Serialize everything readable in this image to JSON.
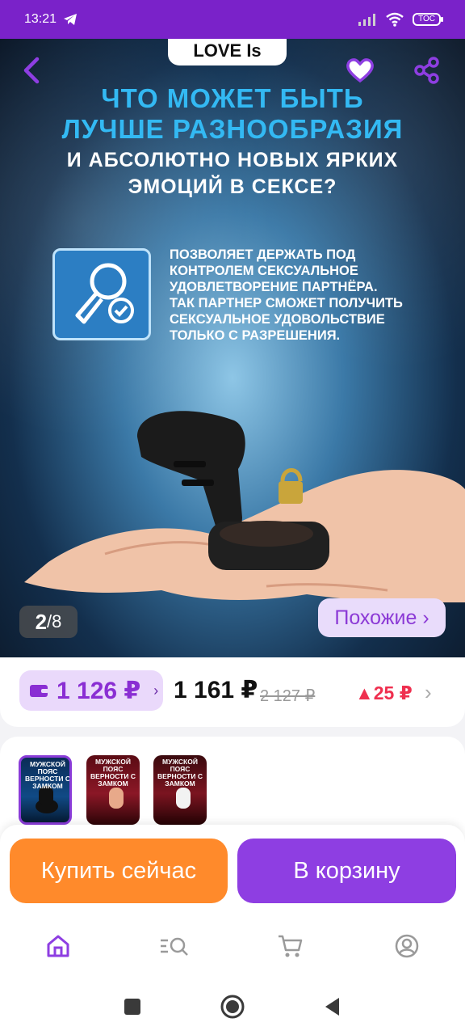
{
  "status_bar": {
    "time": "13:21",
    "battery_label": "TOC"
  },
  "hero": {
    "brand": "LOVE Is",
    "headline_line1": "ЧТО МОЖЕТ БЫТЬ",
    "headline_line2": "ЛУЧШЕ РАЗНООБРАЗИЯ",
    "subheadline_line1": "И АБСОЛЮТНО НОВЫХ ЯРКИХ",
    "subheadline_line2": "ЭМОЦИЙ В СЕКСЕ?",
    "feature_line1": "ПОЗВОЛЯЕТ ДЕРЖАТЬ ПОД",
    "feature_line2": "КОНТРОЛЕМ СЕКСУАЛЬНОЕ",
    "feature_line3": "УДОВЛЕТВОРЕНИЕ ПАРТНЁРА.",
    "feature_line4": "ТАК ПАРТНЕР СМОЖЕТ ПОЛУЧИТЬ",
    "feature_line5": "СЕКСУАЛЬНОЕ УДОВОЛЬСТВИЕ",
    "feature_line6": "ТОЛЬКО С РАЗРЕШЕНИЯ.",
    "page_current": "2",
    "page_total": "8",
    "similar_label": "Похожие ›"
  },
  "pricing": {
    "wallet_price": "1 126 ₽",
    "price": "1 161 ₽",
    "old_price": "2 127 ₽",
    "delta": "▲25 ₽"
  },
  "thumbnails": [
    {
      "title": "МУЖСКОЙ ПОЯС ВЕРНОСТИ С ЗАМКОМ"
    },
    {
      "title": "МУЖСКОЙ ПОЯС ВЕРНОСТИ С ЗАМКОМ"
    },
    {
      "title": "МУЖСКОЙ ПОЯС ВЕРНОСТИ С ЗАМКОМ"
    }
  ],
  "actions": {
    "buy_now": "Купить сейчас",
    "add_to_cart": "В корзину"
  },
  "colors": {
    "accent_purple": "#8e3ee2",
    "orange": "#ff8a2b",
    "price_delta": "#ef2f4f"
  },
  "icons": {
    "back": "chevron-left-icon",
    "favorite": "heart-icon",
    "share": "share-icon",
    "home": "home-icon",
    "catalog": "search-list-icon",
    "cart": "cart-icon",
    "profile": "profile-icon"
  }
}
